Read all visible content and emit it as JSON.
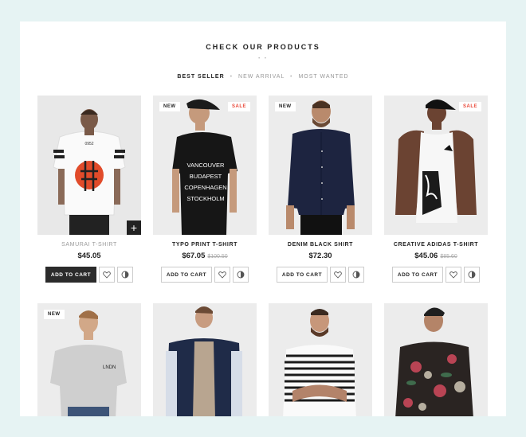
{
  "section": {
    "title": "CHECK OUR PRODUCTS",
    "tabs": [
      "BEST SELLER",
      "NEW ARRIVAL",
      "MOST WANTED"
    ],
    "active_tab": "BEST SELLER"
  },
  "products_row1": [
    {
      "name": "SAMURAI T-SHIRT",
      "price": "$45.05",
      "old_price": "",
      "badge_new": "",
      "badge_sale": "",
      "cart": "ADD TO CART"
    },
    {
      "name": "TYPO PRINT T-SHIRT",
      "price": "$67.05",
      "old_price": "$100.50",
      "badge_new": "NEW",
      "badge_sale": "SALE",
      "cart": "ADD TO CART"
    },
    {
      "name": "DENIM BLACK SHIRT",
      "price": "$72.30",
      "old_price": "",
      "badge_new": "NEW",
      "badge_sale": "",
      "cart": "ADD TO CART"
    },
    {
      "name": "CREATIVE ADIDAS T-SHIRT",
      "price": "$45.06",
      "old_price": "$85.60",
      "badge_new": "",
      "badge_sale": "SALE",
      "cart": "ADD TO CART"
    }
  ],
  "products_row2": [
    {
      "badge_new": "NEW"
    }
  ],
  "print_text": {
    "shirt1": "0952",
    "shirt2_lines": [
      "VANCOUVER",
      "BUDAPEST",
      "COPENHAGEN",
      "STOCKHOLM"
    ],
    "shirt5": "LNDN"
  },
  "colors": {
    "background": "#e6f3f3",
    "sale": "#e94b3c",
    "dark_button": "#2b2b2b"
  },
  "icons": [
    "plus-icon",
    "heart-icon",
    "compare-icon"
  ]
}
